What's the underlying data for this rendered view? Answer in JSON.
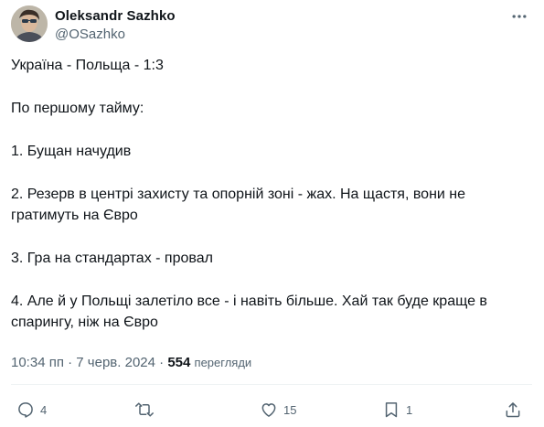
{
  "author": {
    "name": "Oleksandr Sazhko",
    "handle": "@OSazhko"
  },
  "tweet": {
    "paragraphs": [
      [
        "Україна - Польща - 1:3"
      ],
      [
        "По першому тайму:"
      ],
      [
        "1. Бущан начудив"
      ],
      [
        "2. Резерв в центрі захисту та опорній зоні - жах. На щастя, вони не",
        "гратимуть на Євро"
      ],
      [
        "3. Гра на стандартах - провал"
      ],
      [
        "4. Але й у Польщі залетіло все - і навіть більше. Хай так буде краще в",
        "спарингу, ніж на Євро"
      ]
    ]
  },
  "meta": {
    "time": "10:34 пп",
    "separator": "·",
    "date": "7 черв. 2024",
    "views_count": "554",
    "views_label": "перегляди"
  },
  "actions": {
    "reply_count": "4",
    "retweet_count": "",
    "like_count": "15",
    "bookmark_count": "1"
  },
  "icons": {
    "more": "more-horizontal-icon",
    "reply": "reply-icon",
    "retweet": "retweet-icon",
    "like": "heart-icon",
    "bookmark": "bookmark-icon",
    "share": "share-icon"
  },
  "colors": {
    "text": "#0f1419",
    "secondary": "#536471",
    "divider": "#eff3f4"
  }
}
